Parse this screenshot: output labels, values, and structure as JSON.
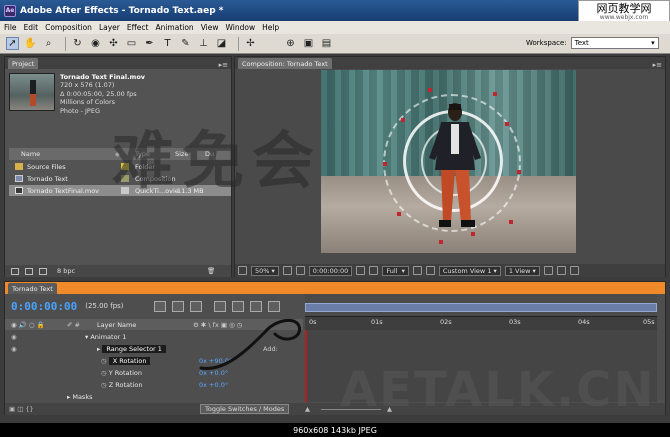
{
  "window": {
    "title": "Adobe After Effects - Tornado Text.aep *",
    "app_icon": "Ae"
  },
  "site_badge": {
    "text": "网页教学网",
    "url": "www.webjx.com"
  },
  "menu": [
    "File",
    "Edit",
    "Composition",
    "Layer",
    "Effect",
    "Animation",
    "View",
    "Window",
    "Help"
  ],
  "workspace": {
    "label": "Workspace:",
    "value": "Text"
  },
  "project": {
    "tab": "Project",
    "item_name": "Tornado Text Final.mov",
    "info": [
      "720 x 576 (1.07)",
      "Δ 0:00:05:00, 25.00 fps",
      "Millions of Colors",
      "Photo - JPEG"
    ],
    "columns": [
      "Name",
      "Type",
      "Size",
      "Du"
    ],
    "rows": [
      {
        "name": "Source Files",
        "type": "Folder",
        "size": "",
        "icon": "folder-icon",
        "swatch": "#d8c03a"
      },
      {
        "name": "Tornado Text",
        "type": "Composition",
        "size": "",
        "icon": "composition-icon",
        "swatch": "#9a9a6a"
      },
      {
        "name": "Tornado TextFinal.mov",
        "type": "QuickTi...ovie",
        "size": "11.3 MB",
        "icon": "footage-icon",
        "swatch": "#c9c9c9"
      }
    ],
    "bpc": "8 bpc"
  },
  "composition": {
    "tab": "Composition: Tornado Text",
    "zoom": "50%",
    "timecode": "0:00:00:00",
    "resolution": "Full",
    "view": "Custom View 1",
    "views": "1 View"
  },
  "timeline": {
    "tab": "Tornado Text",
    "timecode": "0:00:00:00",
    "fps": "(25.00 fps)",
    "col_layer_name": "Layer Name",
    "ruler": [
      "0s",
      "01s",
      "02s",
      "03s",
      "04s",
      "05s"
    ],
    "rows": [
      {
        "label": "Animator 1",
        "value": "",
        "indent": 1
      },
      {
        "label": "Range Selector 1",
        "value": "",
        "indent": 2
      },
      {
        "label": "X Rotation",
        "value": "0x +90.0°",
        "indent": 3,
        "hl": true
      },
      {
        "label": "Y Rotation",
        "value": "0x +0.0°",
        "indent": 3
      },
      {
        "label": "Z Rotation",
        "value": "0x +0.0°",
        "indent": 3
      },
      {
        "label": "Masks",
        "value": "",
        "indent": 1
      }
    ],
    "add_label": "Add:",
    "toggle_label": "Toggle Switches / Modes"
  },
  "watermarks": {
    "cn": "难免会",
    "bottom": "AETALK.CN"
  },
  "status": "960x608  143kb  JPEG"
}
